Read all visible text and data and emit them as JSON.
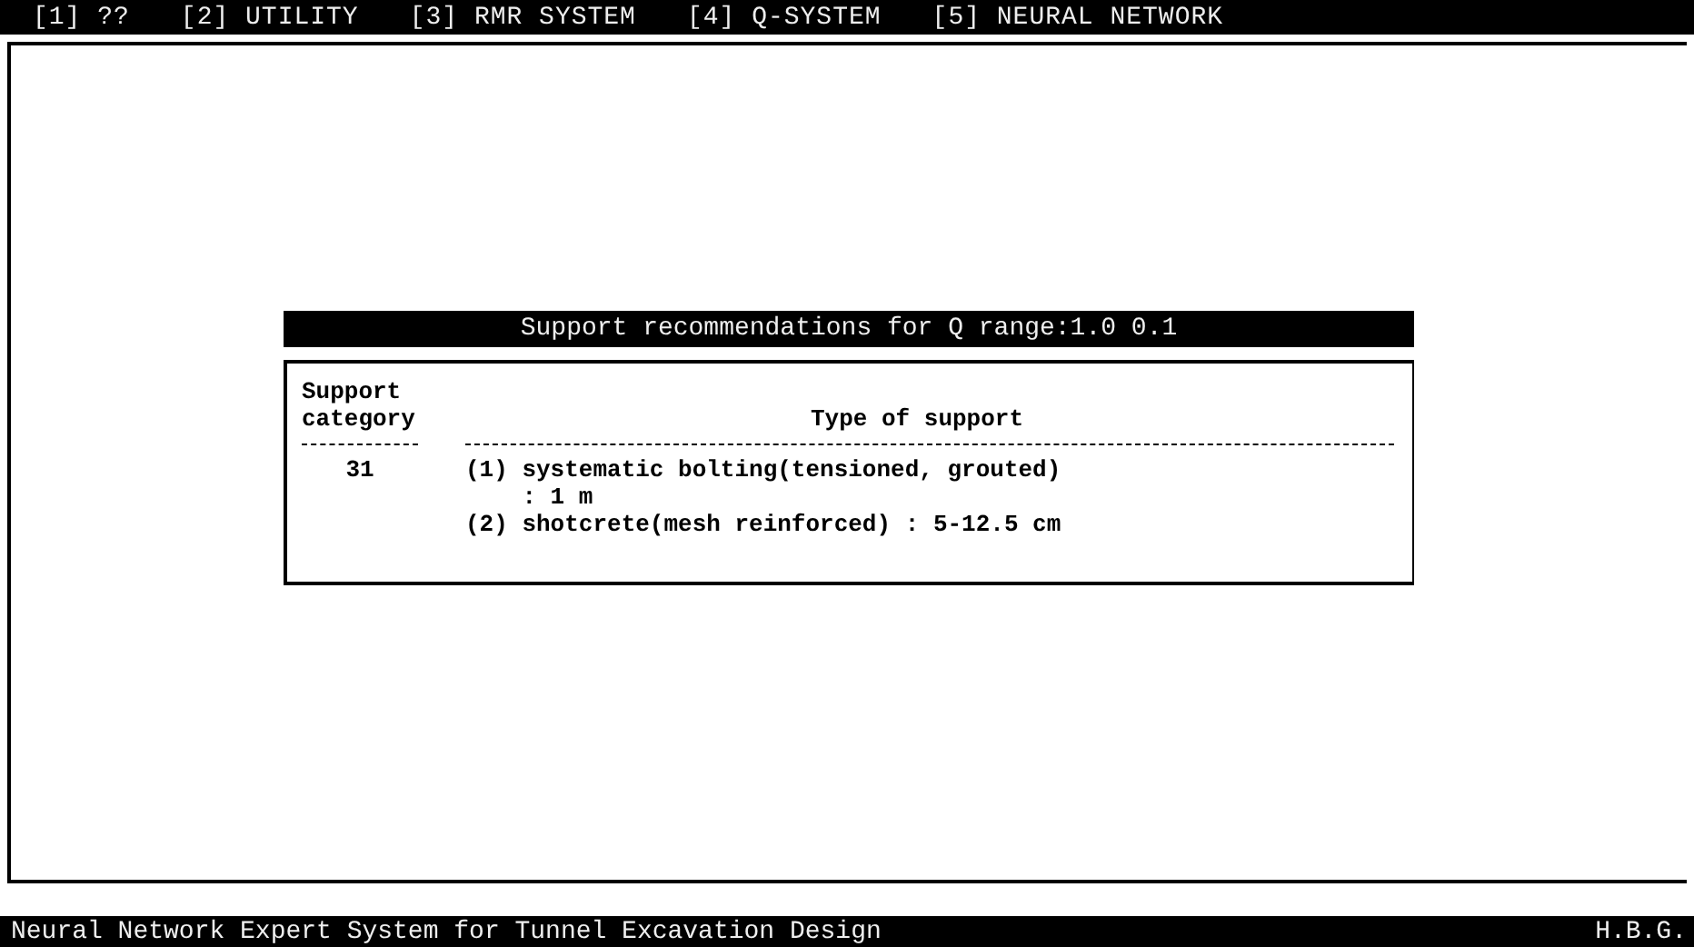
{
  "menu_bar": {
    "items": [
      {
        "label": "[1] ??"
      },
      {
        "label": "[2] UTILITY"
      },
      {
        "label": "[3] RMR SYSTEM"
      },
      {
        "label": "[4] Q-SYSTEM"
      },
      {
        "label": "[5] NEURAL NETWORK"
      }
    ]
  },
  "dialog": {
    "title": "Support recommendations for Q range:1.0 0.1",
    "columns": [
      "Support category",
      "Type of support"
    ],
    "rows": [
      {
        "category": "31",
        "lines": [
          "(1) systematic bolting(tensioned, grouted)",
          "    : 1 m",
          "(2) shotcrete(mesh reinforced) : 5-12.5 cm"
        ]
      }
    ]
  },
  "status_bar": {
    "title": "Neural Network Expert System for Tunnel Excavation Design",
    "author": "H.B.G."
  }
}
